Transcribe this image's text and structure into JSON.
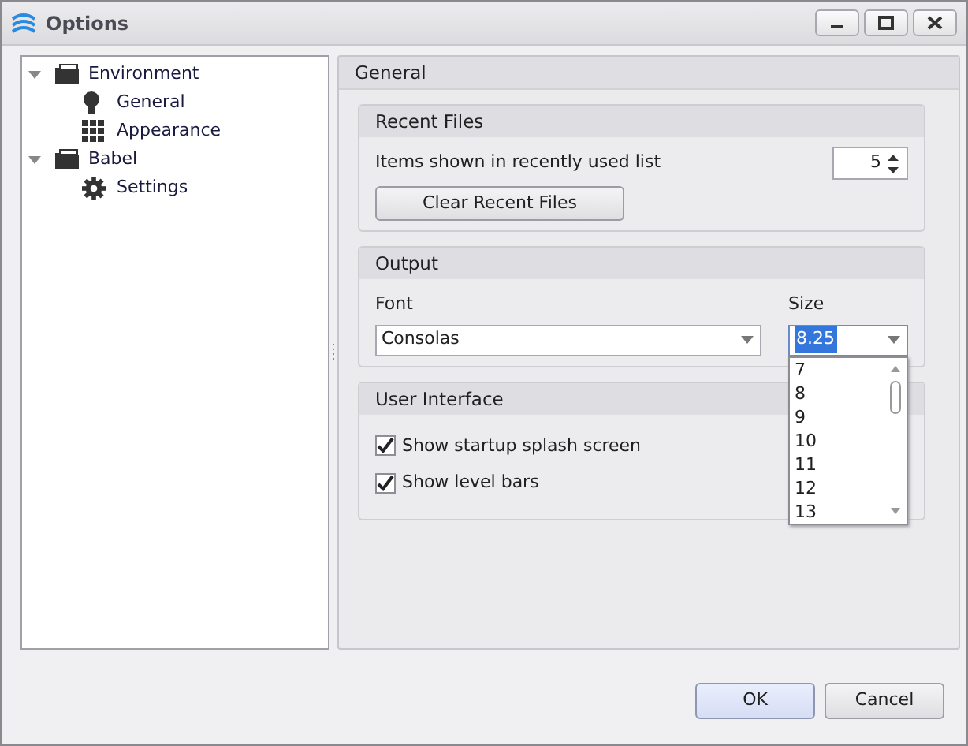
{
  "window": {
    "title": "Options"
  },
  "tree": [
    {
      "label": "Environment",
      "kind": "folder",
      "expanded": true,
      "children": [
        {
          "label": "General",
          "kind": "bulb"
        },
        {
          "label": "Appearance",
          "kind": "grid"
        }
      ]
    },
    {
      "label": "Babel",
      "kind": "folder",
      "expanded": true,
      "children": [
        {
          "label": "Settings",
          "kind": "gear"
        }
      ]
    }
  ],
  "page": {
    "title": "General",
    "recent_files": {
      "title": "Recent Files",
      "items_label": "Items shown in recently used list",
      "items_value": "5",
      "clear_button": "Clear Recent Files"
    },
    "output": {
      "title": "Output",
      "font_label": "Font",
      "font_value": "Consolas",
      "size_label": "Size",
      "size_value": "8.25",
      "size_expanded": true,
      "size_options": [
        "7",
        "8",
        "9",
        "10",
        "11",
        "12",
        "13"
      ]
    },
    "user_interface": {
      "title": "User Interface",
      "options": [
        {
          "label": "Show startup splash screen",
          "checked": true
        },
        {
          "label": "Show level bars",
          "checked": true
        }
      ]
    }
  },
  "buttons": [
    {
      "label": "OK",
      "kind": "default"
    },
    {
      "label": "Cancel",
      "kind": "normal"
    }
  ]
}
